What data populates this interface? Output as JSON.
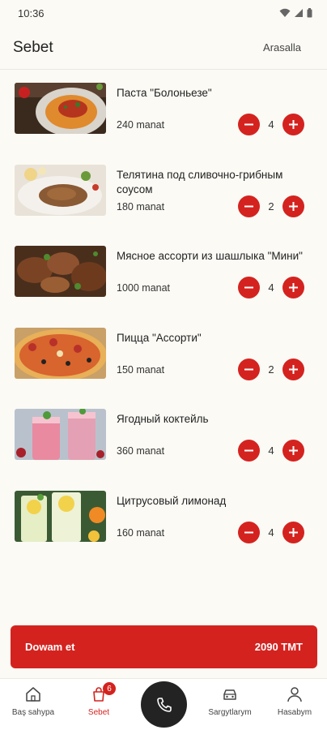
{
  "status_bar": {
    "time": "10:36"
  },
  "header": {
    "title": "Sebet",
    "clear_label": "Arasalla"
  },
  "cart_items": [
    {
      "name": "Паста \"Болоньезе\"",
      "price": "240 manat",
      "quantity": "4"
    },
    {
      "name": "Телятина под сливочно-грибным соусом",
      "price": "180 manat",
      "quantity": "2"
    },
    {
      "name": "Мясное ассорти из шашлыка \"Мини\"",
      "price": "1000 manat",
      "quantity": "4"
    },
    {
      "name": "Пицца \"Ассорти\"",
      "price": "150 manat",
      "quantity": "2"
    },
    {
      "name": "Ягодный коктейль",
      "price": "360 manat",
      "quantity": "4"
    },
    {
      "name": "Цитрусовый лимонад",
      "price": "160 manat",
      "quantity": "4"
    }
  ],
  "checkout": {
    "label": "Dowam et",
    "total": "2090 TMT"
  },
  "bottom_nav": {
    "home": "Baş sahypa",
    "cart": "Sebet",
    "cart_badge": "6",
    "orders": "Sargytlarym",
    "account": "Hasabym"
  },
  "colors": {
    "accent": "#d4231f",
    "fab": "#232323",
    "background": "#fbfaf5"
  }
}
